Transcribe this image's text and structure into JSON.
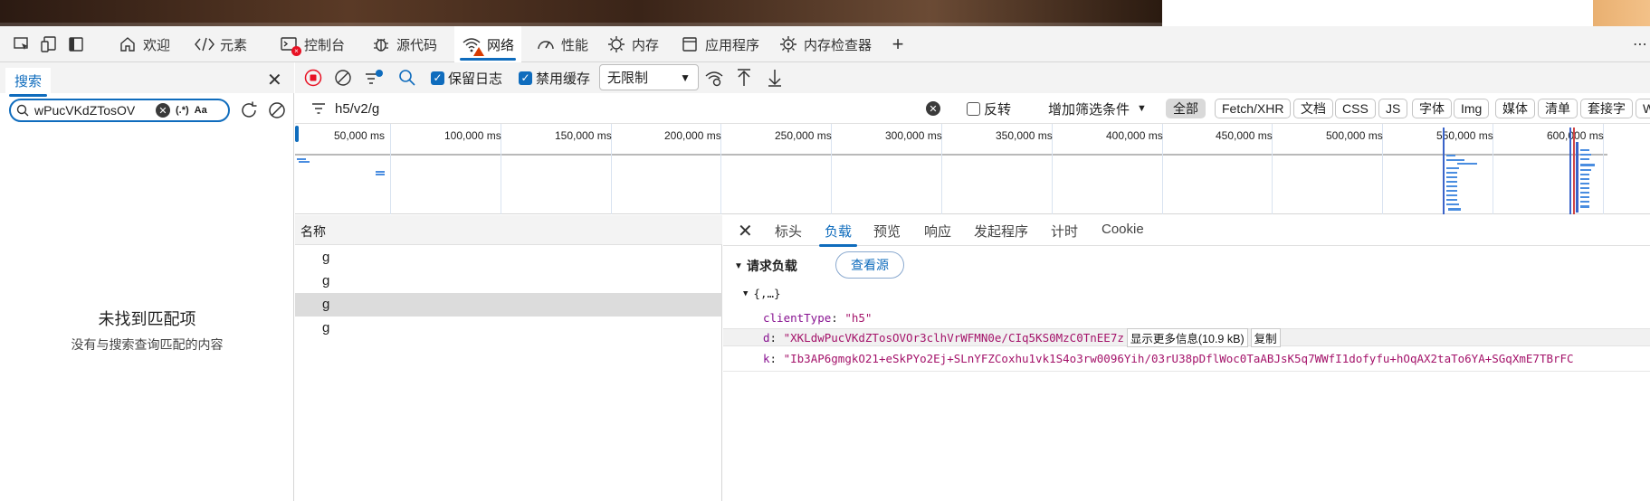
{
  "devtools_tabs": [
    {
      "icon": "home-icon",
      "label": "欢迎"
    },
    {
      "icon": "code-icon",
      "label": "元素"
    },
    {
      "icon": "console-icon",
      "label": "控制台"
    },
    {
      "icon": "bug-icon",
      "label": "源代码"
    },
    {
      "icon": "wifi-icon",
      "label": "网络"
    },
    {
      "icon": "gauge-icon",
      "label": "性能"
    },
    {
      "icon": "memory-icon",
      "label": "内存"
    },
    {
      "icon": "app-icon",
      "label": "应用程序"
    },
    {
      "icon": "memory-inspector-icon",
      "label": "内存检查器"
    }
  ],
  "active_tab": "网络",
  "search_panel": {
    "tab_label": "搜索",
    "query": "wPucVKdZTosOV",
    "regex_label": "(.*)",
    "case_label": "Aa",
    "no_match_title": "未找到匹配项",
    "no_match_desc": "没有与搜索查询匹配的内容"
  },
  "network_toolbar": {
    "preserve_log_label": "保留日志",
    "preserve_log_checked": true,
    "disable_cache_label": "禁用缓存",
    "disable_cache_checked": true,
    "throttling": "无限制"
  },
  "filter_bar": {
    "filter_value": "h5/v2/g",
    "invert_label": "反转",
    "more_filters_label": "增加筛选条件",
    "types": [
      "全部",
      "Fetch/XHR",
      "文档",
      "CSS",
      "JS",
      "字体",
      "Img",
      "媒体",
      "清单",
      "套接字",
      "W"
    ],
    "active_type": "全部"
  },
  "overview": {
    "ticks": [
      "50,000 ms",
      "100,000 ms",
      "150,000 ms",
      "200,000 ms",
      "250,000 ms",
      "300,000 ms",
      "350,000 ms",
      "400,000 ms",
      "450,000 ms",
      "500,000 ms",
      "550,000 ms",
      "600,000 ms"
    ]
  },
  "request_list": {
    "header": "名称",
    "rows": [
      {
        "name": "g",
        "selected": false
      },
      {
        "name": "g",
        "selected": false
      },
      {
        "name": "g",
        "selected": true
      },
      {
        "name": "g",
        "selected": false
      }
    ]
  },
  "detail": {
    "tabs": [
      "标头",
      "负载",
      "预览",
      "响应",
      "发起程序",
      "计时",
      "Cookie"
    ],
    "active_tab": "负载",
    "section_title": "请求负载",
    "view_source_label": "查看源",
    "object_summary": "{,…}",
    "payload": {
      "clientType_key": "clientType",
      "clientType_value": "\"h5\"",
      "d_key": "d",
      "d_value": "\"XKLdwPucVKdZTosOVOr3clhVrWFMN0e/CIq5KS0MzC0TnEE7z",
      "show_more_label": "显示更多信息(10.9 kB)",
      "copy_label": "复制",
      "k_key": "k",
      "k_value": "\"Ib3AP6gmgkO21+eSkPYo2Ej+SLnYFZCoxhu1vk1S4o3rw0096Yih/03rU38pDflWoc0TaABJsK5q7WWfI1dofyfu+hOqAX2taTo6YA+SGqXmE7TBrFC"
    }
  },
  "colors": {
    "accent": "#0f6cbd",
    "record_red": "#e81123",
    "key_purple": "#881391",
    "string_magenta": "#a4136a"
  }
}
